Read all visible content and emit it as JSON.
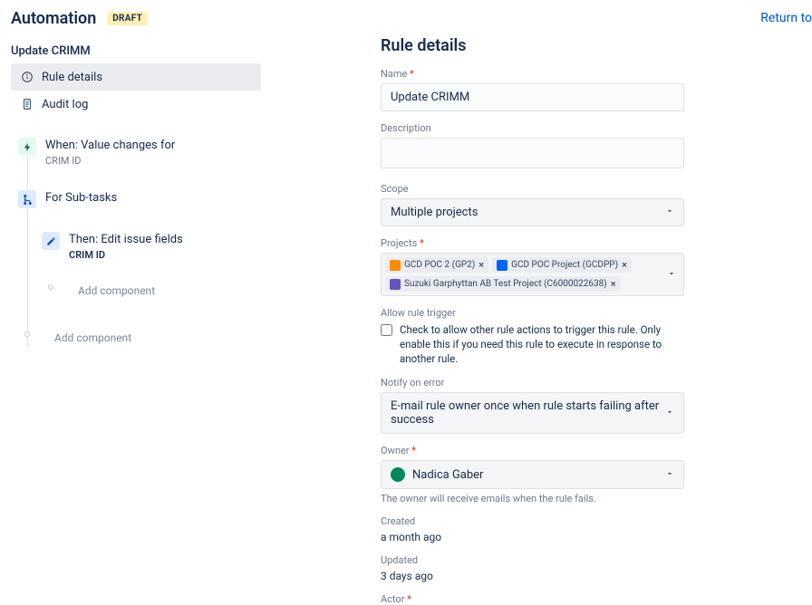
{
  "topLink": "Return to",
  "header": {
    "title": "Automation",
    "badge": "DRAFT"
  },
  "ruleName": "Update CRIMM",
  "nav": {
    "ruleDetails": "Rule details",
    "auditLog": "Audit log"
  },
  "flow": {
    "trigger": {
      "label": "When: Value changes for",
      "sub": "CRIM ID"
    },
    "branch": {
      "label": "For Sub-tasks"
    },
    "action": {
      "label": "Then: Edit issue fields",
      "sub": "CRIM ID"
    },
    "addInner": "Add component",
    "addOuter": "Add component"
  },
  "details": {
    "sectionTitle": "Rule details",
    "nameLabel": "Name",
    "nameValue": "Update CRIMM",
    "descLabel": "Description",
    "descValue": "",
    "scopeLabel": "Scope",
    "scopeValue": "Multiple projects",
    "projectsLabel": "Projects",
    "projects": [
      {
        "name": "GCD POC 2 (GP2)",
        "icon": "a"
      },
      {
        "name": "GCD POC Project (GCDPP)",
        "icon": "b"
      },
      {
        "name": "Suzuki Garphyttan AB Test Project (C6000022638)",
        "icon": "c"
      }
    ],
    "allowLabel": "Allow rule trigger",
    "allowText": "Check to allow other rule actions to trigger this rule. Only enable this if you need this rule to execute in response to another rule.",
    "notifyLabel": "Notify on error",
    "notifyValue": "E-mail rule owner once when rule starts failing after success",
    "ownerLabel": "Owner",
    "ownerValue": "Nadica Gaber",
    "ownerHelp": "The owner will receive emails when the rule fails.",
    "createdLabel": "Created",
    "createdValue": "a month ago",
    "updatedLabel": "Updated",
    "updatedValue": "3 days ago",
    "actorLabel": "Actor"
  }
}
